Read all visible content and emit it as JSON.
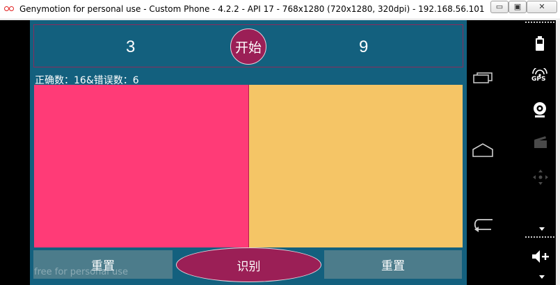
{
  "window": {
    "title": "Genymotion for personal use - Custom Phone - 4.2.2 - API 17 - 768x1280 (720x1280, 320dpi) - 192.168.56.101",
    "minimize_glyph": "▭",
    "maximize_glyph": "▣",
    "close_glyph": "✕"
  },
  "app": {
    "left_number": "3",
    "right_number": "9",
    "start_label": "开始",
    "stats_text": "正确数：16&错误数：6",
    "left_panel_color": "#ff3b77",
    "right_panel_color": "#f5c566",
    "reset_left_label": "重置",
    "recognize_label": "识别",
    "reset_right_label": "重置",
    "watermark": "free for personal use"
  },
  "navbar": {
    "icons": [
      "recent-apps-icon",
      "home-icon",
      "back-icon"
    ]
  },
  "sidebar": {
    "gps_label": "GPS",
    "icons": [
      "battery-icon",
      "gps-icon",
      "webcam-icon",
      "media-icon",
      "dpad-icon",
      "volume-up-icon"
    ]
  },
  "colors": {
    "app_background": "#13607e",
    "accent_button": "#9b1f56",
    "secondary_button": "#4c7c8b"
  }
}
